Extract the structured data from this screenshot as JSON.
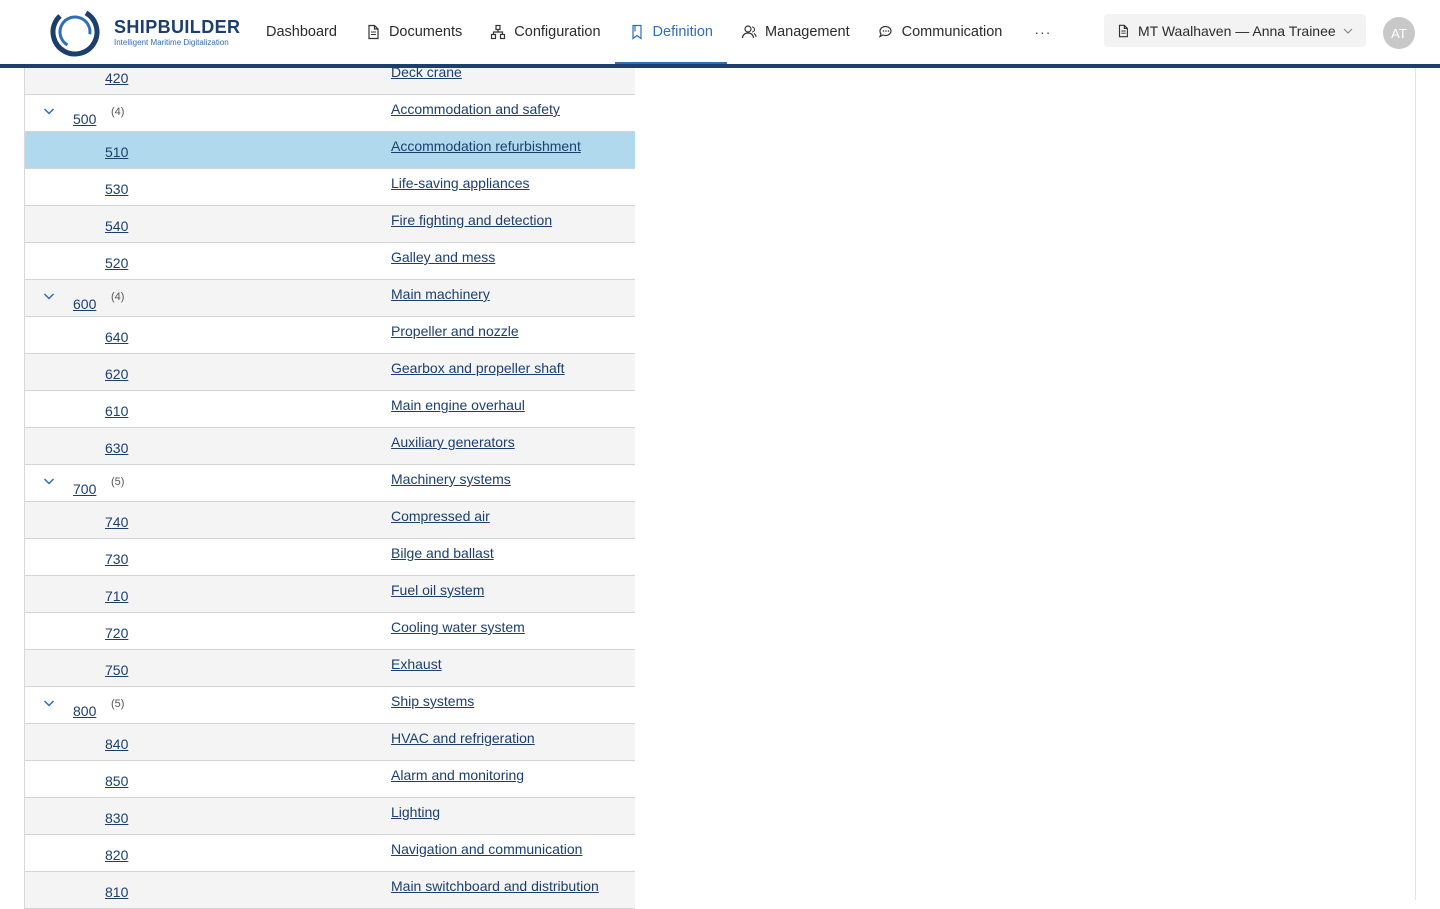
{
  "brand": {
    "name": "SHIPBUILDER",
    "tagline": "Intelligent Maritime Digitalization"
  },
  "nav": [
    {
      "label": "Dashboard",
      "icon": "none"
    },
    {
      "label": "Documents",
      "icon": "document-icon"
    },
    {
      "label": "Configuration",
      "icon": "hierarchy-icon"
    },
    {
      "label": "Definition",
      "icon": "bookmark-icon",
      "active": true
    },
    {
      "label": "Management",
      "icon": "users-icon"
    },
    {
      "label": "Communication",
      "icon": "chat-icon"
    }
  ],
  "nav_more": "···",
  "vessel_selector": {
    "label": "MT Waalhaven — Anna Trainee"
  },
  "avatar": {
    "initials": "AT"
  },
  "colors": {
    "brand_navy": "#1c3f6e",
    "accent_blue": "#2f6fb3",
    "selected_row": "#b1d9ee",
    "alt_row": "#f4f4f4"
  },
  "tree_rows": [
    {
      "type": "child",
      "code": "420",
      "desc": "Deck crane"
    },
    {
      "type": "group",
      "code": "500",
      "count": "(4)",
      "desc": "Accommodation and safety"
    },
    {
      "type": "child",
      "code": "510",
      "desc": "Accommodation refurbishment",
      "selected": true
    },
    {
      "type": "child",
      "code": "530",
      "desc": "Life-saving appliances"
    },
    {
      "type": "child",
      "code": "540",
      "desc": "Fire fighting and detection"
    },
    {
      "type": "child",
      "code": "520",
      "desc": "Galley and mess"
    },
    {
      "type": "group",
      "code": "600",
      "count": "(4)",
      "desc": "Main machinery"
    },
    {
      "type": "child",
      "code": "640",
      "desc": "Propeller and nozzle"
    },
    {
      "type": "child",
      "code": "620",
      "desc": "Gearbox and propeller shaft"
    },
    {
      "type": "child",
      "code": "610",
      "desc": "Main engine overhaul"
    },
    {
      "type": "child",
      "code": "630",
      "desc": "Auxiliary generators"
    },
    {
      "type": "group",
      "code": "700",
      "count": "(5)",
      "desc": "Machinery systems"
    },
    {
      "type": "child",
      "code": "740",
      "desc": "Compressed air"
    },
    {
      "type": "child",
      "code": "730",
      "desc": "Bilge and ballast"
    },
    {
      "type": "child",
      "code": "710",
      "desc": "Fuel oil system"
    },
    {
      "type": "child",
      "code": "720",
      "desc": "Cooling water system"
    },
    {
      "type": "child",
      "code": "750",
      "desc": "Exhaust"
    },
    {
      "type": "group",
      "code": "800",
      "count": "(5)",
      "desc": "Ship systems"
    },
    {
      "type": "child",
      "code": "840",
      "desc": "HVAC and refrigeration"
    },
    {
      "type": "child",
      "code": "850",
      "desc": "Alarm and monitoring"
    },
    {
      "type": "child",
      "code": "830",
      "desc": "Lighting"
    },
    {
      "type": "child",
      "code": "820",
      "desc": "Navigation and communication"
    },
    {
      "type": "child",
      "code": "810",
      "desc": "Main switchboard and distribution"
    }
  ]
}
